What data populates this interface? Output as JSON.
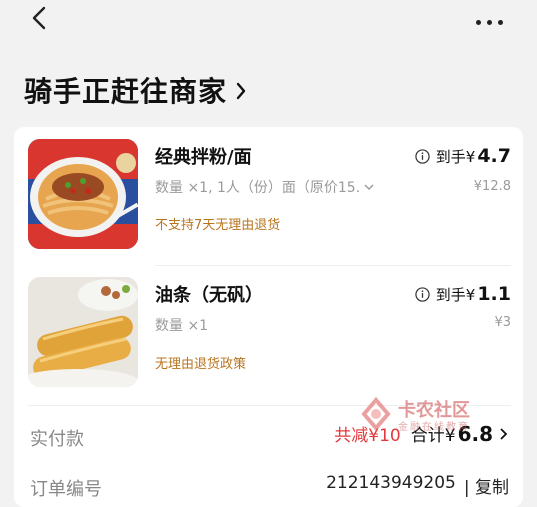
{
  "title": "骑手正赶往商家",
  "items": [
    {
      "name": "经典拌粉/面",
      "qty": "数量 ×1, 1人（份）面（原价15.",
      "policy": "不支持7天无理由退货",
      "price_prefix": "到手¥",
      "price": "4.7",
      "original": "¥12.8",
      "image": "noodle-bowl"
    },
    {
      "name": "油条（无矾）",
      "qty": "数量 ×1",
      "policy": "无理由退货政策",
      "price_prefix": "到手¥",
      "price": "1.1",
      "original": "¥3",
      "image": "fried-dough-sticks"
    }
  ],
  "payment": {
    "label": "实付款",
    "discount": "共减¥10",
    "total_prefix": "合计¥",
    "total": "6.8"
  },
  "order": {
    "label": "订单编号",
    "number": "212143949205",
    "copy": "| 复制"
  },
  "watermark": {
    "brand": "卡农社区",
    "sub": "金融在线教育"
  },
  "colors": {
    "policy": "#b9751f",
    "discount": "#e4393c"
  }
}
